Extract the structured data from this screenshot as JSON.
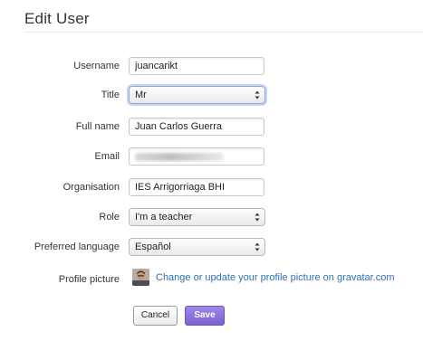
{
  "header": {
    "title": "Edit User"
  },
  "form": {
    "username": {
      "label": "Username",
      "value": "juancarikt"
    },
    "title": {
      "label": "Title",
      "value": "Mr"
    },
    "full_name": {
      "label": "Full name",
      "value": "Juan Carlos Guerra"
    },
    "email": {
      "label": "Email",
      "value": ""
    },
    "organisation": {
      "label": "Organisation",
      "value": "IES Arrigorriaga BHI"
    },
    "role": {
      "label": "Role",
      "value": "I'm a teacher"
    },
    "preferred_language": {
      "label": "Preferred language",
      "value": "Español"
    },
    "profile_picture": {
      "label": "Profile picture",
      "link_text": "Change or update your profile picture on gravatar.com"
    }
  },
  "actions": {
    "cancel_label": "Cancel",
    "save_label": "Save"
  },
  "colors": {
    "link": "#2e6fb0",
    "save_button": "#7c61cf",
    "focus_ring": "#c6d7f2"
  },
  "icons": {
    "select_arrows": "up-down-chevron-icon",
    "avatar": "user-avatar-photo"
  }
}
